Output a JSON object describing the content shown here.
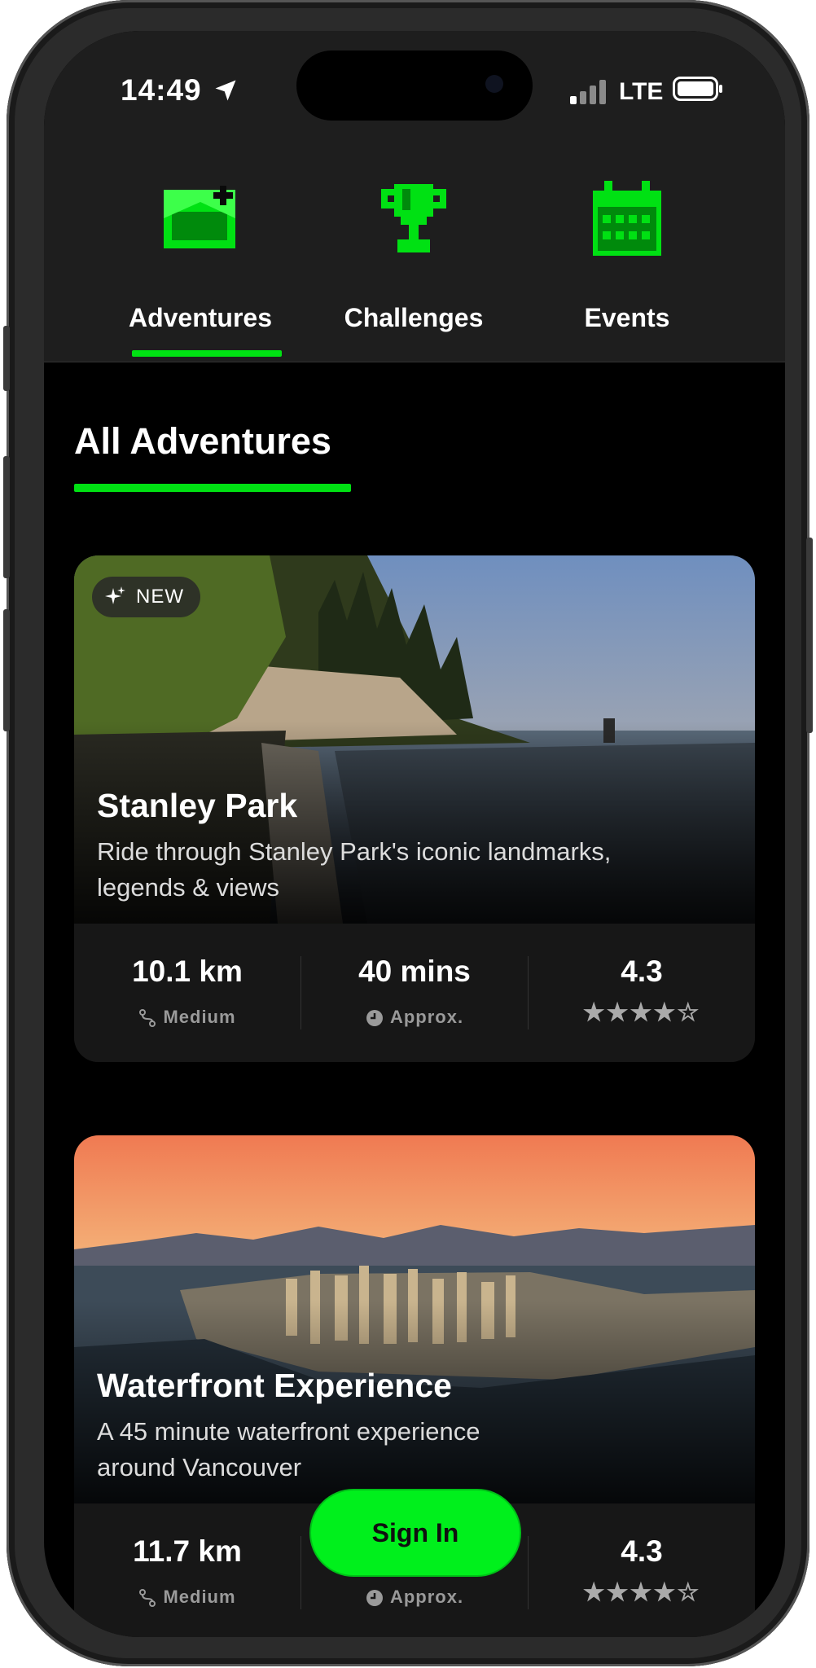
{
  "status_bar": {
    "time": "14:49",
    "network": "LTE"
  },
  "tabs": [
    {
      "label": "Adventures",
      "icon": "adventures-icon",
      "active": true
    },
    {
      "label": "Challenges",
      "icon": "trophy-icon",
      "active": false
    },
    {
      "label": "Events",
      "icon": "calendar-icon",
      "active": false
    }
  ],
  "section_title": "All Adventures",
  "cards": [
    {
      "badge": "NEW",
      "title": "Stanley Park",
      "description": "Ride through Stanley Park's iconic landmarks, legends & views",
      "distance": "10.1 km",
      "difficulty": "Medium",
      "duration": "40 mins",
      "duration_note": "Approx.",
      "rating": "4.3",
      "stars": "★★★★☆"
    },
    {
      "title": "Waterfront Experience",
      "description": "A 45 minute waterfront experience around Vancouver",
      "distance": "11.7 km",
      "difficulty": "Medium",
      "duration_note": "Approx.",
      "rating": "4.3",
      "stars": "★★★★☆"
    }
  ],
  "sign_in_label": "Sign In",
  "colors": {
    "accent": "#00e113",
    "background": "#000000",
    "surface": "#1e1e1e"
  }
}
